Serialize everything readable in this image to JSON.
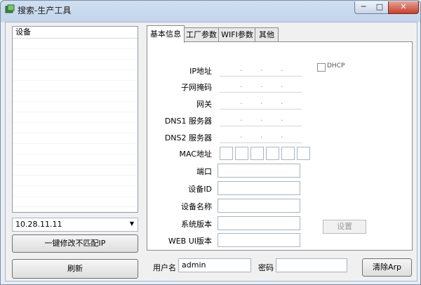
{
  "window": {
    "title": "搜索-生产工具",
    "minimize": "─",
    "maximize": "□",
    "close": "✕"
  },
  "device_list": {
    "header": "设备",
    "selected_ip": "10.28.11.11"
  },
  "buttons": {
    "batch_modify": "一键修改不匹配IP",
    "refresh": "刷新",
    "settings": "设置",
    "clear_arp": "清除Arp"
  },
  "tabs": [
    "基本信息",
    "工厂参数",
    "WIFI参数",
    "其他"
  ],
  "fields": {
    "ip": "IP地址",
    "subnet": "子网掩码",
    "gateway": "网关",
    "dns1": "DNS1 服务器",
    "dns2": "DNS2 服务器",
    "mac": "MAC地址",
    "port": "端口",
    "device_id": "设备ID",
    "device_name": "设备名称",
    "sys_version": "系统版本",
    "web_ui_version": "WEB UI版本"
  },
  "ip_separator": ".",
  "dhcp_label": "DHCP",
  "login": {
    "user_label": "用户名",
    "user_value": "admin",
    "password_label": "密码",
    "password_value": ""
  }
}
